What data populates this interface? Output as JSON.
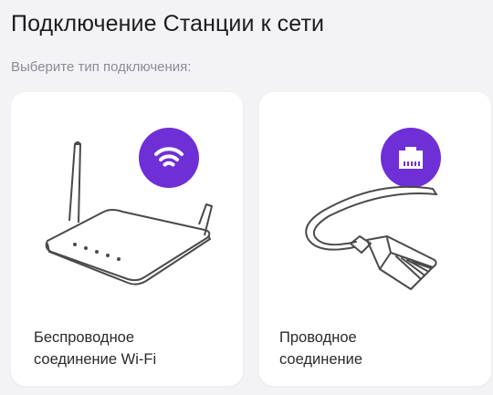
{
  "header": {
    "title": "Подключение Станции к сети",
    "subtitle": "Выберите тип подключения:"
  },
  "options": [
    {
      "id": "wifi",
      "line1": "Беспроводное",
      "line2": "соединение Wi-Fi",
      "icon": "wifi-icon"
    },
    {
      "id": "wired",
      "line1": "Проводное",
      "line2": "соединение",
      "icon": "ethernet-port-icon"
    }
  ],
  "colors": {
    "accent": "#6f2fd6",
    "background": "#f3f3f5",
    "card": "#ffffff",
    "subtitle": "#8c8b96"
  }
}
